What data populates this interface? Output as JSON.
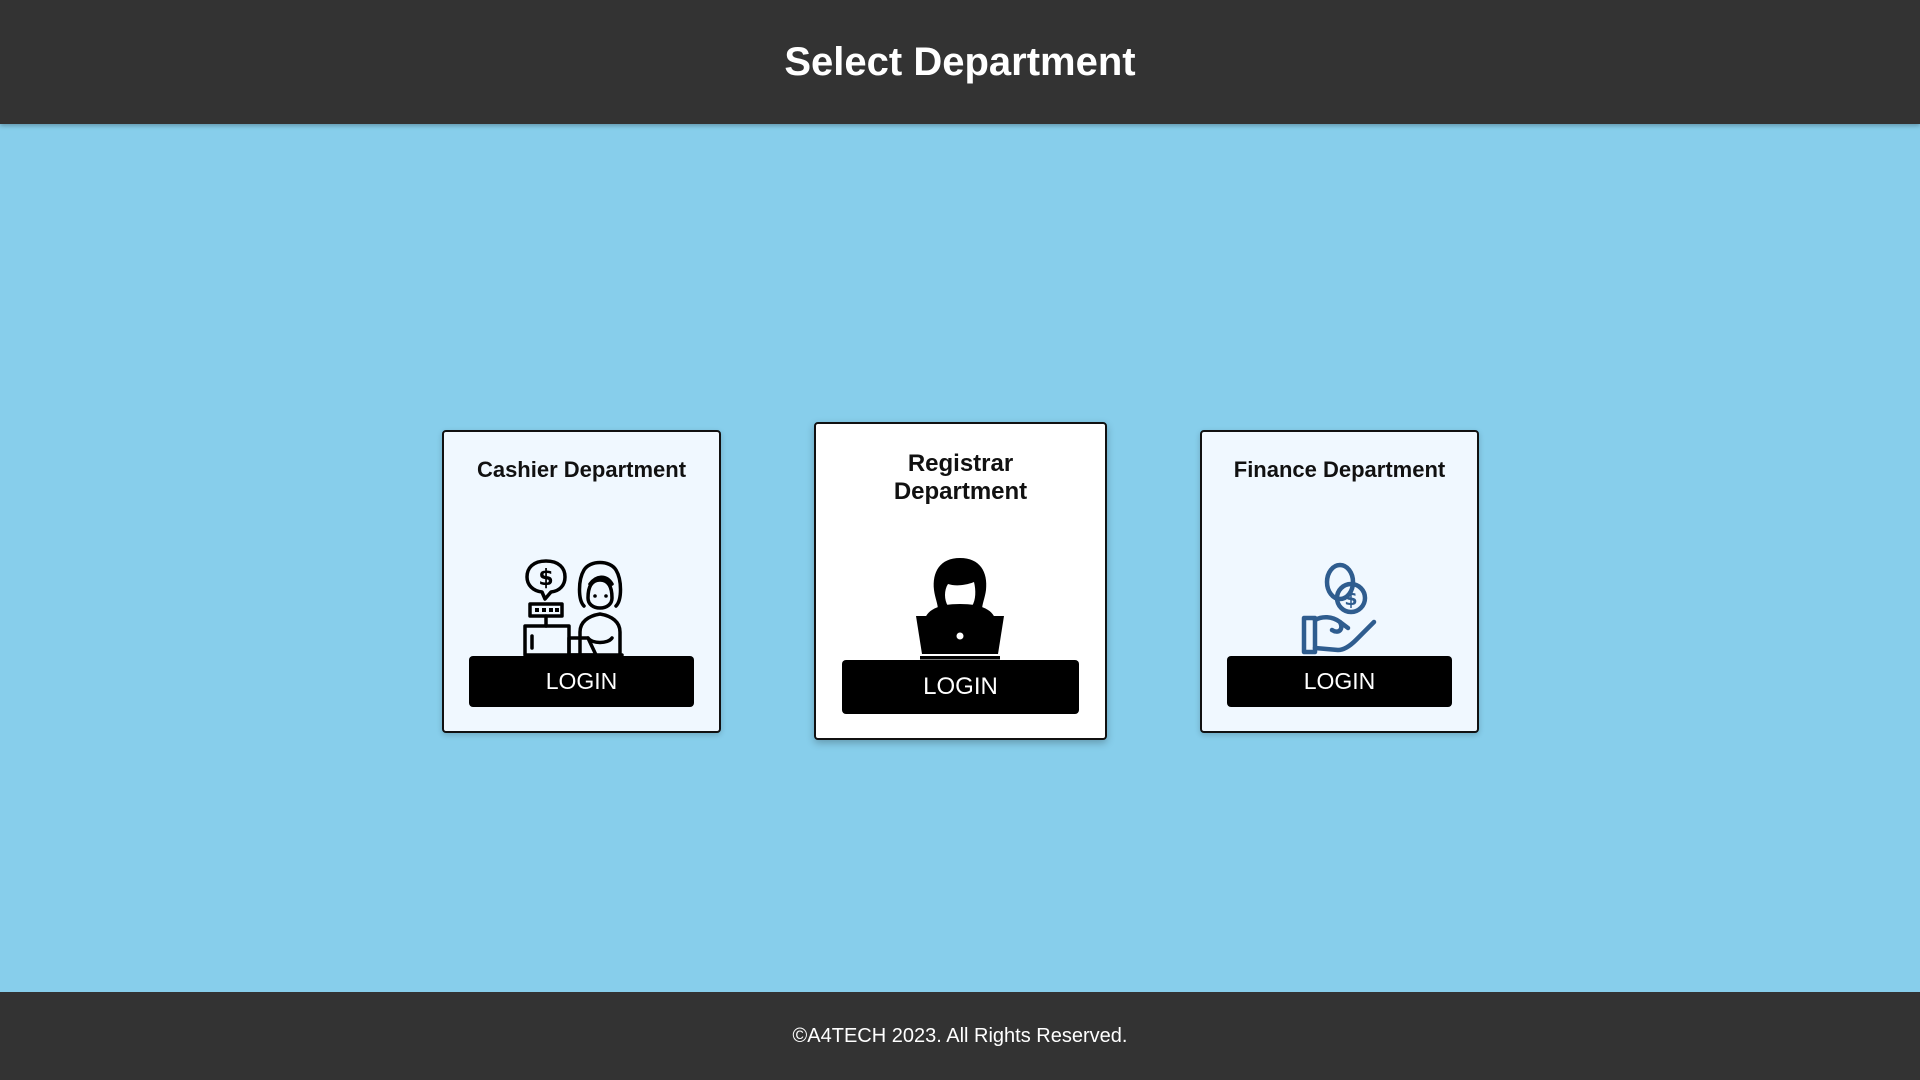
{
  "header": {
    "title": "Select Department"
  },
  "departments": [
    {
      "name": "Cashier Department",
      "icon": "cashier-icon",
      "login_label": "LOGIN"
    },
    {
      "name": "Registrar Department",
      "icon": "registrar-laptop-icon",
      "login_label": "LOGIN"
    },
    {
      "name": "Finance Department",
      "icon": "money-hand-icon",
      "login_label": "LOGIN"
    }
  ],
  "footer": {
    "copyright": "©A4TECH 2023. All Rights Reserved."
  },
  "colors": {
    "page_background": "#87CEEB",
    "bar_background": "#333333",
    "card_background": "#F0F8FF",
    "button_background": "#000000",
    "finance_icon": "#2F5D8F"
  }
}
